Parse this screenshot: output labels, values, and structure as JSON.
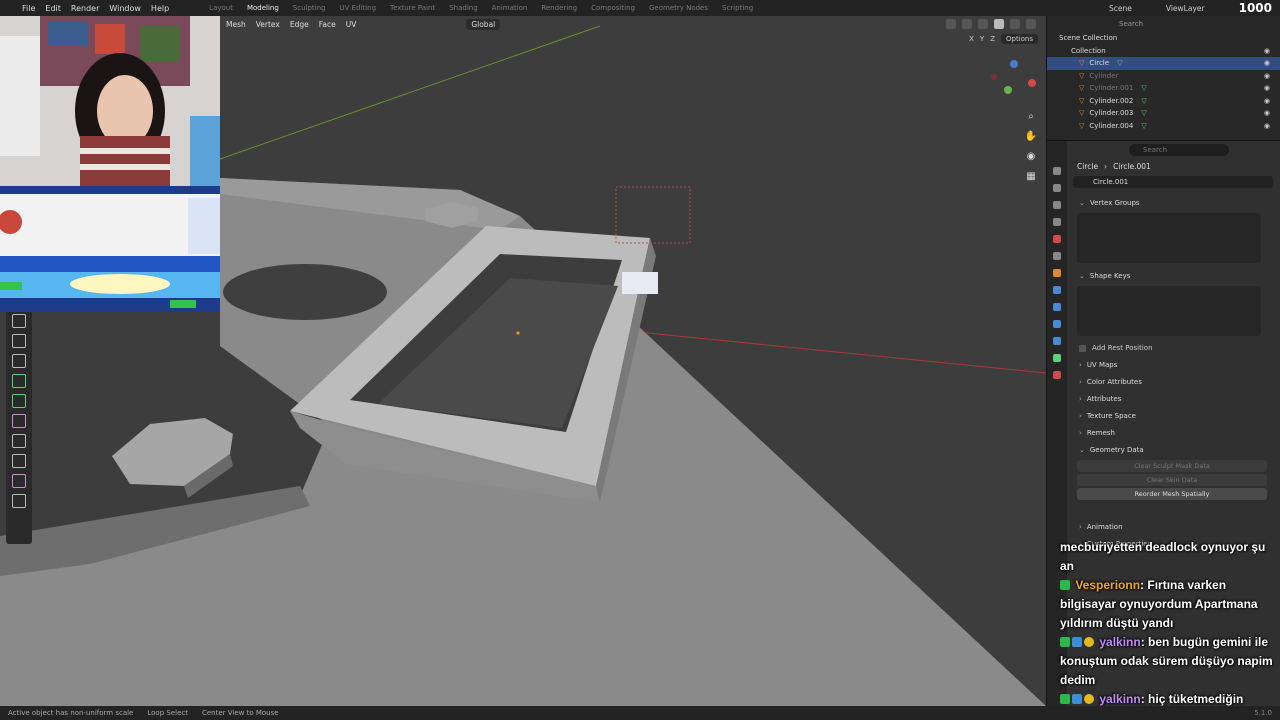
{
  "topbar": {
    "menus": [
      "File",
      "Edit",
      "Render",
      "Window",
      "Help"
    ],
    "workspaces": [
      "Layout",
      "Modeling",
      "Sculpting",
      "UV Editing",
      "Texture Paint",
      "Shading",
      "Animation",
      "Rendering",
      "Compositing",
      "Geometry Nodes",
      "Scripting"
    ],
    "active_workspace": "Modeling",
    "scene": "Scene",
    "view_layer": "ViewLayer",
    "counter": "1000"
  },
  "viewport_header": {
    "menus": [
      "Mesh",
      "Vertex",
      "Edge",
      "Face",
      "UV"
    ],
    "orientation": "Global",
    "axes": [
      "X",
      "Y",
      "Z"
    ],
    "options": "Options"
  },
  "outliner": {
    "search_placeholder": "Search",
    "scene_collection": "Scene Collection",
    "collection": "Collection",
    "items": [
      {
        "name": "Circle",
        "selected": true
      },
      {
        "name": "Cylinder",
        "dim": true
      },
      {
        "name": "Cylinder.001",
        "dim": true
      },
      {
        "name": "Cylinder.002"
      },
      {
        "name": "Cylinder.003"
      },
      {
        "name": "Cylinder.004"
      }
    ]
  },
  "properties": {
    "search_placeholder": "Search",
    "object": "Circle",
    "mesh": "Circle.001",
    "mesh_name": "Circle.001",
    "panels": {
      "vertex_groups": "Vertex Groups",
      "shape_keys": "Shape Keys",
      "add_rest_position": "Add Rest Position",
      "uv_maps": "UV Maps",
      "color_attributes": "Color Attributes",
      "attributes": "Attributes",
      "texture_space": "Texture Space",
      "remesh": "Remesh",
      "geometry_data": "Geometry Data",
      "clear_sculpt": "Clear Sculpt Mask Data",
      "clear_skin": "Clear Skin Data",
      "reorder_mesh": "Reorder Mesh Spatially",
      "animation": "Animation",
      "custom_properties": "Custom Properties"
    }
  },
  "chat": {
    "line0": "mecburiyetten deadlock oynuyor şu an",
    "msg1_user": "Vesperionn",
    "msg1_text": ": Fırtına varken bilgisayar oynuyordum Apartmana yıldırım düştü yandı",
    "msg2_user": "yalkinn",
    "msg2_text": ": ben bugün gemini ile konuştum odak sürem düşüyo napim dedim",
    "msg3_user": "yalkinn",
    "msg3_text": ": hiç tüketmediğin tarzda eserler tüket dedi"
  },
  "statusbar": {
    "warning": "Active object has non-uniform scale",
    "loop_select": "Loop Select",
    "center_view": "Center View to Mouse",
    "version": "5.1.0"
  }
}
